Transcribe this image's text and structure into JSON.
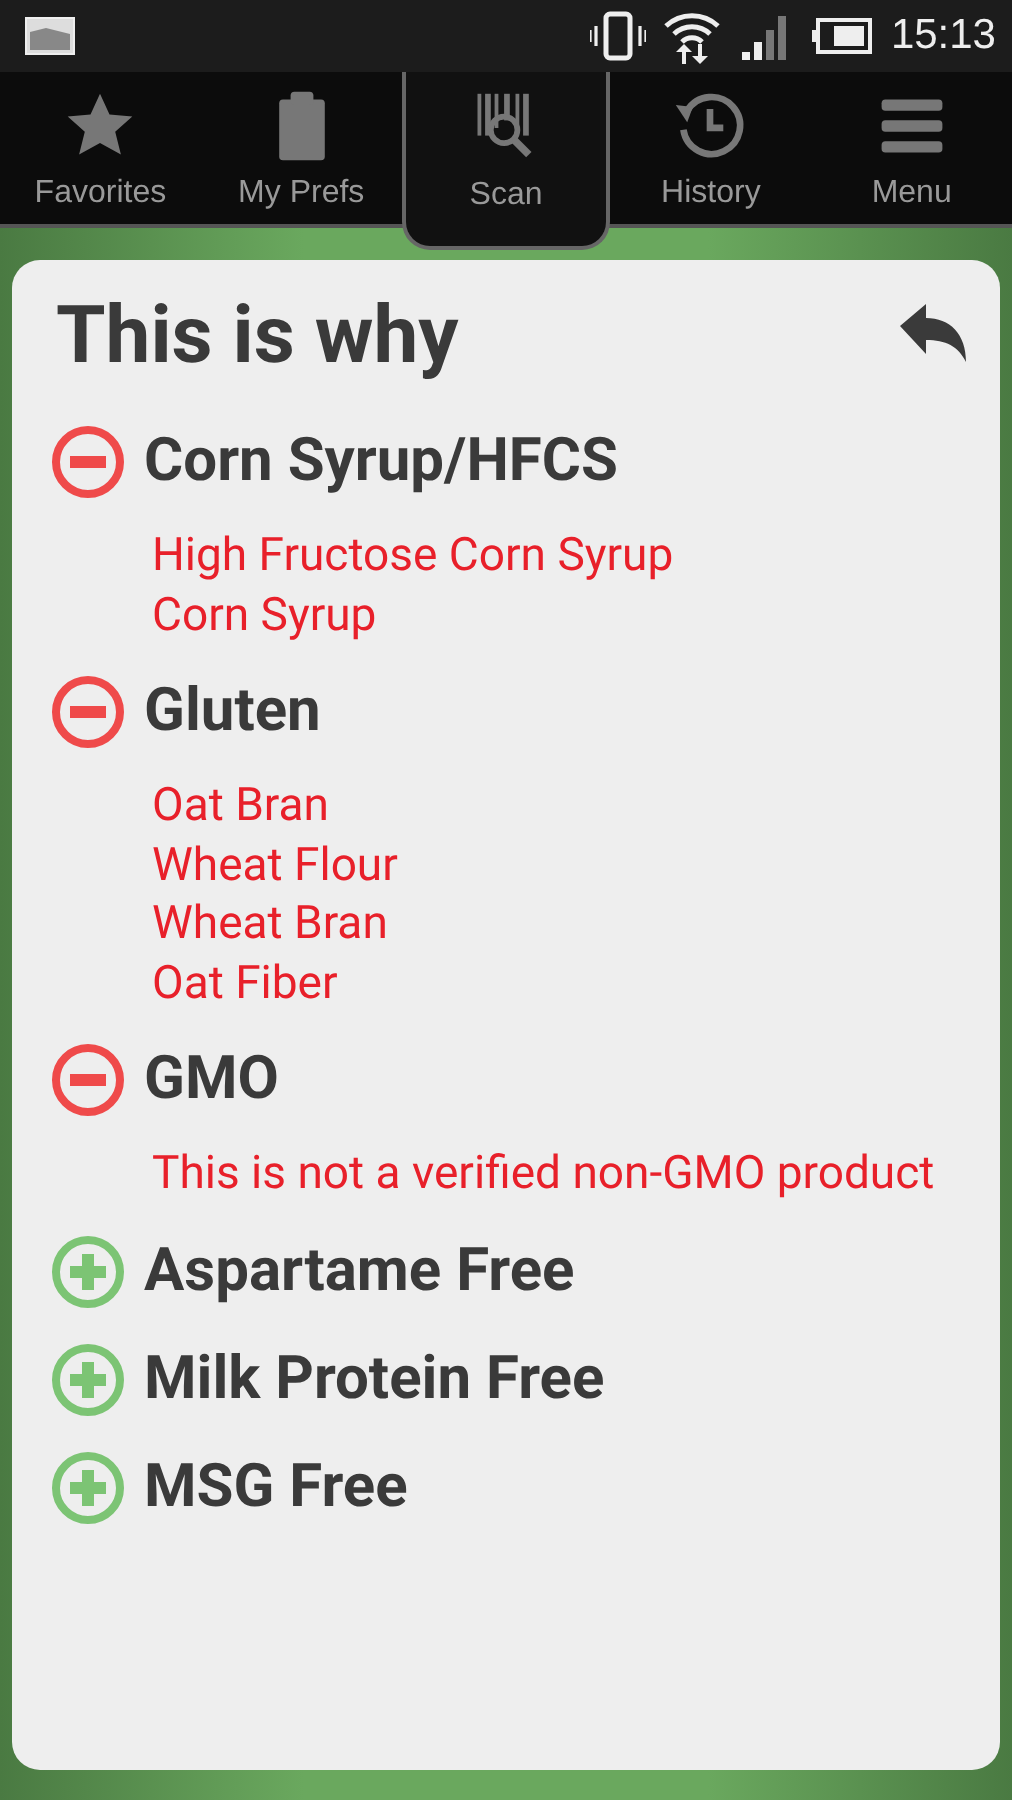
{
  "status_bar": {
    "time": "15:13"
  },
  "tabs": [
    {
      "label": "Favorites",
      "selected": false
    },
    {
      "label": "My Prefs",
      "selected": false
    },
    {
      "label": "Scan",
      "selected": true
    },
    {
      "label": "History",
      "selected": false
    },
    {
      "label": "Menu",
      "selected": false
    }
  ],
  "card": {
    "title": "This is why",
    "items": [
      {
        "kind": "avoid",
        "name": "Corn Syrup/HFCS",
        "details": [
          "High Fructose Corn Syrup",
          "Corn Syrup"
        ]
      },
      {
        "kind": "avoid",
        "name": "Gluten",
        "details": [
          "Oat Bran",
          "Wheat Flour",
          "Wheat Bran",
          "Oat Fiber"
        ]
      },
      {
        "kind": "avoid",
        "name": "GMO",
        "details": [
          "This is not a verified non-GMO product"
        ]
      },
      {
        "kind": "ok",
        "name": "Aspartame Free"
      },
      {
        "kind": "ok",
        "name": "Milk Protein Free"
      },
      {
        "kind": "ok",
        "name": "MSG Free"
      }
    ]
  }
}
